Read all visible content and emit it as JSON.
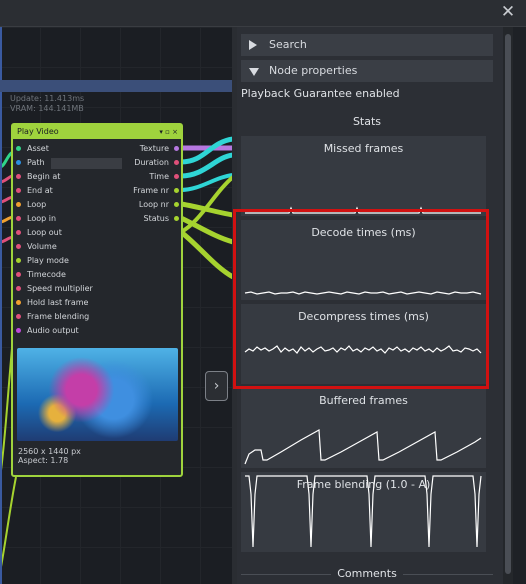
{
  "window": {
    "close_label": "✕"
  },
  "canvas": {
    "stats_line1": "Update: 11.413ms",
    "stats_line2": "VRAM: 144.141MB"
  },
  "node": {
    "title": "Play Video",
    "controls": "▾ ▫ ×",
    "inputs": [
      {
        "label": "Asset",
        "color": "#2fd58a"
      },
      {
        "label": "Path",
        "color": "#2b8fe0"
      },
      {
        "label": "Begin at",
        "color": "#e0507a"
      },
      {
        "label": "End at",
        "color": "#e0507a"
      },
      {
        "label": "Loop",
        "color": "#f0a030"
      },
      {
        "label": "Loop in",
        "color": "#e0507a"
      },
      {
        "label": "Loop out",
        "color": "#e0507a"
      },
      {
        "label": "Volume",
        "color": "#e0507a"
      },
      {
        "label": "Play mode",
        "color": "#a6d32f"
      },
      {
        "label": "Timecode",
        "color": "#e0507a"
      },
      {
        "label": "Speed multiplier",
        "color": "#e0507a"
      },
      {
        "label": "Hold last frame",
        "color": "#f0a030"
      },
      {
        "label": "Frame blending",
        "color": "#e0507a"
      },
      {
        "label": "Audio output",
        "color": "#c04ad8"
      }
    ],
    "outputs": [
      {
        "label": "Texture",
        "color": "#b678e0"
      },
      {
        "label": "Duration",
        "color": "#e0507a"
      },
      {
        "label": "Time",
        "color": "#e0507a"
      },
      {
        "label": "Frame nr",
        "color": "#a6d32f"
      },
      {
        "label": "Loop nr",
        "color": "#a6d32f"
      },
      {
        "label": "Status",
        "color": "#a6d32f"
      }
    ],
    "resolution": "2560 x 1440 px",
    "aspect": "Aspect: 1.78"
  },
  "panel": {
    "search_label": "Search",
    "node_properties_label": "Node properties",
    "playback_text": "Playback Guarantee enabled",
    "stats_heading": "Stats",
    "comments_heading": "Comments",
    "graphs": [
      {
        "title": "Missed frames"
      },
      {
        "title": "Decode times (ms)"
      },
      {
        "title": "Decompress times (ms)"
      },
      {
        "title": "Buffered frames"
      },
      {
        "title": "Frame blending (1.0 - A)"
      }
    ]
  },
  "colors": {
    "accent": "#9fd33d",
    "highlight": "#d11111",
    "panel": "#2c2f35"
  }
}
